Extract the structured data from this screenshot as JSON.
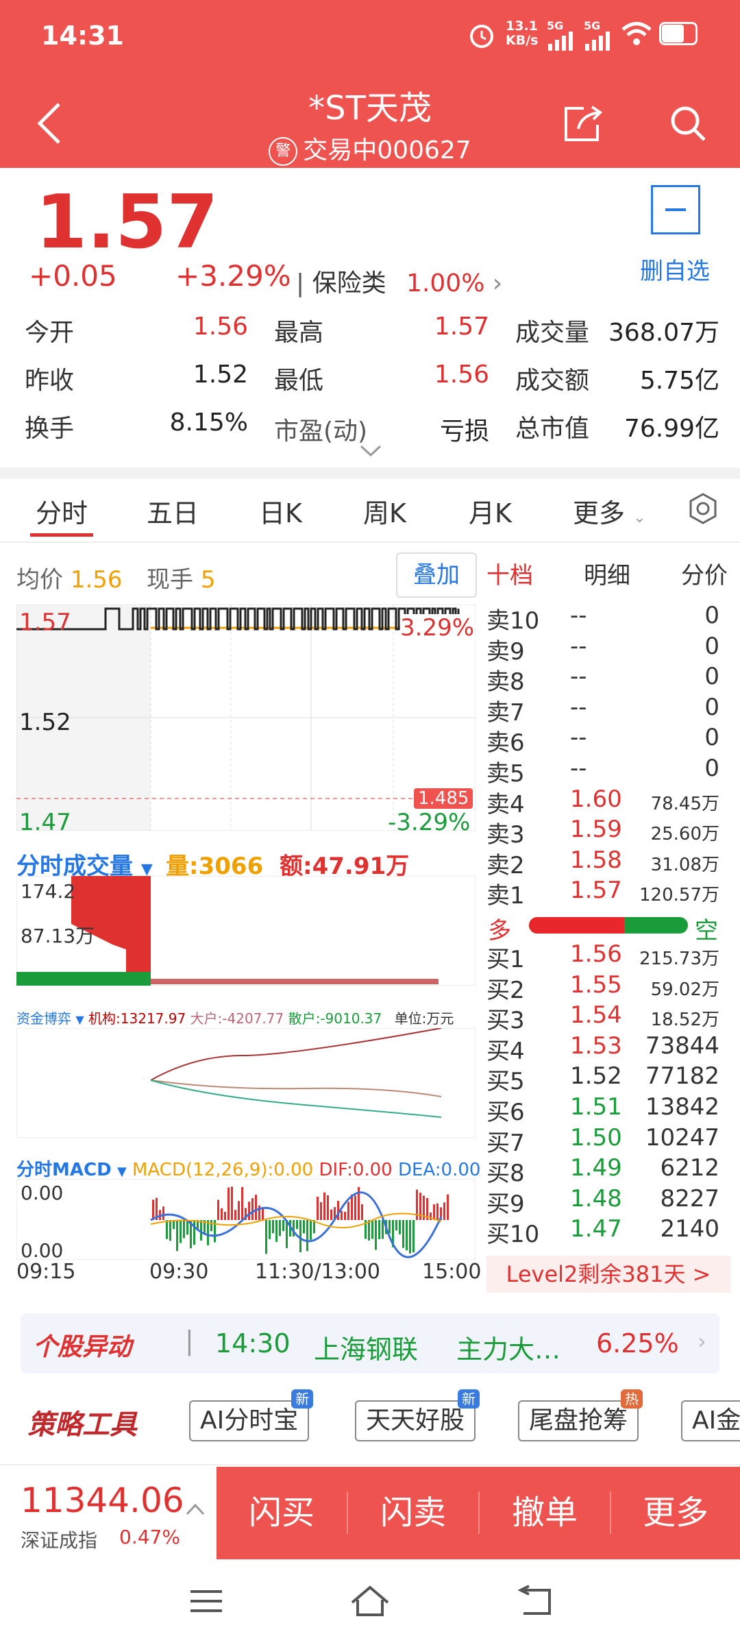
{
  "status": {
    "time": "14:31",
    "net_speed_top": "13.1",
    "net_speed_bottom": "KB/s",
    "sig1": "5G",
    "sig2": "5G"
  },
  "header": {
    "title": "*ST天茂",
    "warn_glyph": "警",
    "status": "交易中",
    "code": "000627"
  },
  "quote": {
    "price": "1.57",
    "change": "+0.05",
    "change_pct": "+3.29%",
    "sector": "保险类",
    "sector_pct": "1.00%",
    "fav_label": "删自选",
    "stats": [
      {
        "label": "今开",
        "value": "1.56"
      },
      {
        "label": "最高",
        "value": "1.57"
      },
      {
        "label": "成交量",
        "value": "368.07万"
      },
      {
        "label": "昨收",
        "value": "1.52"
      },
      {
        "label": "最低",
        "value": "1.56"
      },
      {
        "label": "成交额",
        "value": "5.75亿"
      },
      {
        "label": "换手",
        "value": "8.15%"
      },
      {
        "label": "市盈(动)",
        "value": "亏损"
      },
      {
        "label": "总市值",
        "value": "76.99亿"
      }
    ]
  },
  "tabs": [
    "分时",
    "五日",
    "日K",
    "周K",
    "月K",
    "更多"
  ],
  "chart": {
    "avg_label": "均价",
    "avg_value": "1.56",
    "vol_label": "现手",
    "vol_value": "5",
    "overlay_btn": "叠加",
    "price_high": "1.57",
    "price_mid": "1.52",
    "price_low": "1.47",
    "pct_high": "3.29%",
    "pct_low": "-3.29%",
    "limit_mark": "1.485",
    "vol_title": "分时成交量",
    "vol_qty_label": "量:3066",
    "vol_amt_label": "额:47.91万",
    "vol_tick_top": "174.2",
    "vol_tick_mid": "87.13万",
    "fund_title": "资金博弈",
    "fund_inst": "机构:13217.97",
    "fund_big": "大户:-4207.77",
    "fund_retail": "散户:-9010.37",
    "fund_unit": "单位:万元",
    "macd_title": "分时MACD",
    "macd_params": "MACD(12,26,9):0.00",
    "macd_dif": "DIF:0.00",
    "macd_dea": "DEA:0.00",
    "macd_top": "0.00",
    "macd_bottom": "0.00",
    "times": [
      "09:15",
      "09:30",
      "11:30/13:00",
      "15:00"
    ]
  },
  "orderbook": {
    "tabs": [
      "十档",
      "明细",
      "分价"
    ],
    "asks": [
      {
        "name": "卖10",
        "price": "--",
        "vol": "0"
      },
      {
        "name": "卖9",
        "price": "--",
        "vol": "0"
      },
      {
        "name": "卖8",
        "price": "--",
        "vol": "0"
      },
      {
        "name": "卖7",
        "price": "--",
        "vol": "0"
      },
      {
        "name": "卖6",
        "price": "--",
        "vol": "0"
      },
      {
        "name": "卖5",
        "price": "--",
        "vol": "0"
      },
      {
        "name": "卖4",
        "price": "1.60",
        "vol": "78.45万"
      },
      {
        "name": "卖3",
        "price": "1.59",
        "vol": "25.60万"
      },
      {
        "name": "卖2",
        "price": "1.58",
        "vol": "31.08万"
      },
      {
        "name": "卖1",
        "price": "1.57",
        "vol": "120.57万"
      }
    ],
    "bull_label": "多",
    "bear_label": "空",
    "bull_ratio": 0.6,
    "bids": [
      {
        "name": "买1",
        "price": "1.56",
        "vol": "215.73万"
      },
      {
        "name": "买2",
        "price": "1.55",
        "vol": "59.02万"
      },
      {
        "name": "买3",
        "price": "1.54",
        "vol": "18.52万"
      },
      {
        "name": "买4",
        "price": "1.53",
        "vol": "73844"
      },
      {
        "name": "买5",
        "price": "1.52",
        "vol": "77182"
      },
      {
        "name": "买6",
        "price": "1.51",
        "vol": "13842"
      },
      {
        "name": "买7",
        "price": "1.50",
        "vol": "10247"
      },
      {
        "name": "买8",
        "price": "1.49",
        "vol": "6212"
      },
      {
        "name": "买9",
        "price": "1.48",
        "vol": "8227"
      },
      {
        "name": "买10",
        "price": "1.47",
        "vol": "2140"
      }
    ],
    "level2": "Level2剩余381天 >"
  },
  "news": {
    "brand": "个股异动",
    "time": "14:30",
    "source": "上海钢联",
    "text": "主力大…",
    "pct": "6.25%"
  },
  "tools": {
    "brand": "策略工具",
    "chips": [
      {
        "label": "AI分时宝",
        "badge": "新"
      },
      {
        "label": "天天好股",
        "badge": "新"
      },
      {
        "label": "尾盘抢筹",
        "badge": "热"
      },
      {
        "label": "AI金"
      }
    ]
  },
  "bottom": {
    "index_value": "11344.06",
    "index_name": "深证成指",
    "index_pct": "0.47%",
    "buttons": [
      "闪买",
      "闪卖",
      "撤单",
      "更多"
    ]
  },
  "colors": {
    "header": "#ee5350",
    "up": "#e03131",
    "down": "#1a9c3a",
    "accent": "#2577e3"
  }
}
